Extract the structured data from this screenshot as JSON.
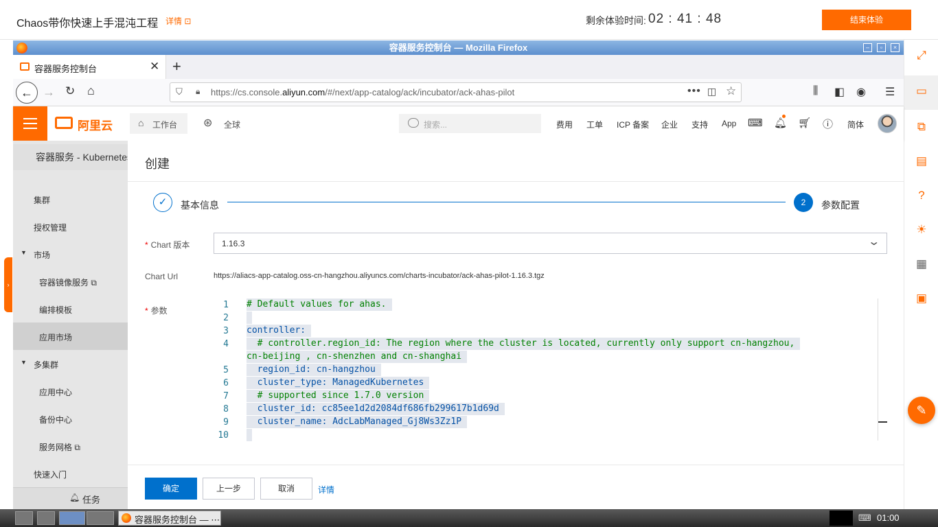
{
  "lab": {
    "title": "Chaos带你快速上手混沌工程",
    "detail_link": "详情 ⊡",
    "timer_label": "剩余体验时间:",
    "timer": "02 : 41 : 48",
    "end_button": "结束体验"
  },
  "firefox": {
    "window_title": "容器服务控制台 — Mozilla Firefox",
    "tab_label": "容器服务控制台",
    "url_prefix": "https://cs.console.",
    "url_domain": "aliyun.com",
    "url_suffix": "/#/next/app-catalog/ack/incubator/ack-ahas-pilot"
  },
  "header": {
    "logo_text": "阿里云",
    "workspace": "工作台",
    "region": "全球",
    "search_placeholder": "搜索...",
    "nav": [
      "费用",
      "工单",
      "ICP 备案",
      "企业",
      "支持",
      "App"
    ],
    "lang": "简体"
  },
  "sidebar": {
    "title": "容器服务 - Kubernetes",
    "items": [
      {
        "label": "集群"
      },
      {
        "label": "授权管理"
      },
      {
        "label": "市场"
      },
      {
        "label": "容器镜像服务 ⧉"
      },
      {
        "label": "编排模板"
      },
      {
        "label": "应用市场"
      },
      {
        "label": "多集群"
      },
      {
        "label": "应用中心"
      },
      {
        "label": "备份中心"
      },
      {
        "label": "服务网格 ⧉"
      },
      {
        "label": "快速入门"
      }
    ],
    "task": "任务"
  },
  "main": {
    "title": "创建",
    "steps": [
      {
        "label": "基本信息",
        "marker": "✓"
      },
      {
        "label": "参数配置",
        "marker": "2"
      }
    ],
    "chart_version_label": "Chart 版本",
    "chart_version": "1.16.3",
    "chart_url_label": "Chart Url",
    "chart_url": "https://aliacs-app-catalog.oss-cn-hangzhou.aliyuncs.com/charts-incubator/ack-ahas-pilot-1.16.3.tgz",
    "params_label": "参数",
    "code": [
      {
        "n": "1",
        "text": "# Default values for ahas."
      },
      {
        "n": "2",
        "text": ""
      },
      {
        "n": "3",
        "text": "controller:"
      },
      {
        "n": "4",
        "text": "  # controller.region_id: The region where the cluster is located, currently only support cn-hangzhou,"
      },
      {
        "n": "",
        "text": "cn-beijing , cn-shenzhen and cn-shanghai"
      },
      {
        "n": "5",
        "text": "  region_id: cn-hangzhou"
      },
      {
        "n": "6",
        "text": "  cluster_type: ManagedKubernetes"
      },
      {
        "n": "7",
        "text": "  # supported since 1.7.0 version"
      },
      {
        "n": "8",
        "text": "  cluster_id: cc85ee1d2d2084df686fb299617b1d69d"
      },
      {
        "n": "9",
        "text": "  cluster_name: AdcLabManaged_Gj8Ws3Zz1P"
      },
      {
        "n": "10",
        "text": ""
      }
    ],
    "buttons": {
      "ok": "确定",
      "prev": "上一步",
      "cancel": "取消",
      "detail": "详情"
    }
  },
  "taskbar": {
    "app_label": "容器服务控制台 — ⋯",
    "clock": "01:00"
  },
  "colors": {
    "brand": "#ff6a00",
    "primary": "#0070cc"
  }
}
